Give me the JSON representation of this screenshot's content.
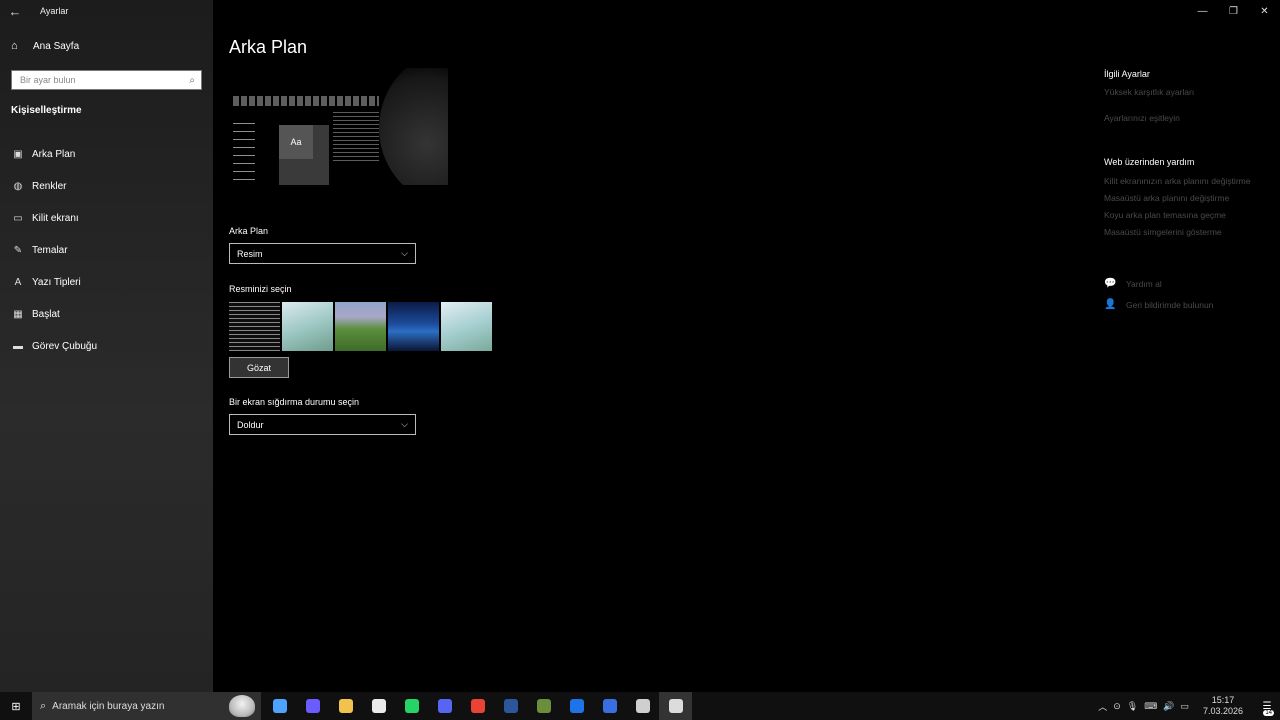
{
  "window": {
    "title": "Ayarlar",
    "minimize": "—",
    "restore": "❐",
    "close": "✕"
  },
  "sidebar": {
    "home_label": "Ana Sayfa",
    "search_placeholder": "Bir ayar bulun",
    "section_title": "Kişiselleştirme",
    "items": [
      {
        "label": "Arka Plan",
        "icon": "picture-icon"
      },
      {
        "label": "Renkler",
        "icon": "palette-icon"
      },
      {
        "label": "Kilit ekranı",
        "icon": "lock-screen-icon"
      },
      {
        "label": "Temalar",
        "icon": "brush-icon"
      },
      {
        "label": "Yazı Tipleri",
        "icon": "font-icon"
      },
      {
        "label": "Başlat",
        "icon": "start-icon"
      },
      {
        "label": "Görev Çubuğu",
        "icon": "taskbar-icon"
      }
    ]
  },
  "main": {
    "title": "Arka Plan",
    "preview_tile_text": "Aa",
    "background_label": "Arka Plan",
    "background_value": "Resim",
    "choose_picture_label": "Resminizi seçin",
    "browse_button": "Gözat",
    "fit_label": "Bir ekran sığdırma durumu seçin",
    "fit_value": "Doldur"
  },
  "related": {
    "title": "İlgili Ayarlar",
    "links": [
      "Yüksek karşıtlık ayarları",
      "Ayarlarınızı eşitleyin"
    ]
  },
  "web_help": {
    "title": "Web üzerinden yardım",
    "links": [
      "Kilit ekranınızın arka planını değiştirme",
      "Masaüstü arka planını değiştirme",
      "Koyu arka plan temasına geçme",
      "Masaüstü simgelerini gösterme"
    ]
  },
  "support": {
    "get_help": "Yardım al",
    "feedback": "Geri bildirimde bulunun"
  },
  "taskbar": {
    "search_text": "Aramak için buraya yazın",
    "time": "15:17",
    "date": "7.03.2026",
    "notification_count": "14",
    "apps": [
      {
        "name": "task-view",
        "color": "#4da3ff"
      },
      {
        "name": "copilot",
        "color": "#6a5cff"
      },
      {
        "name": "file-explorer",
        "color": "#f2c14e"
      },
      {
        "name": "store",
        "color": "#eaeaea"
      },
      {
        "name": "whatsapp",
        "color": "#25d366"
      },
      {
        "name": "discord",
        "color": "#5865f2"
      },
      {
        "name": "chrome",
        "color": "#ea4335"
      },
      {
        "name": "word",
        "color": "#2b579a"
      },
      {
        "name": "minecraft",
        "color": "#6b8e3d"
      },
      {
        "name": "security",
        "color": "#1e73e8"
      },
      {
        "name": "roblox",
        "color": "#3a6fe2"
      },
      {
        "name": "browser",
        "color": "#cfcfcf"
      },
      {
        "name": "settings",
        "color": "#dcdcdc"
      }
    ]
  }
}
